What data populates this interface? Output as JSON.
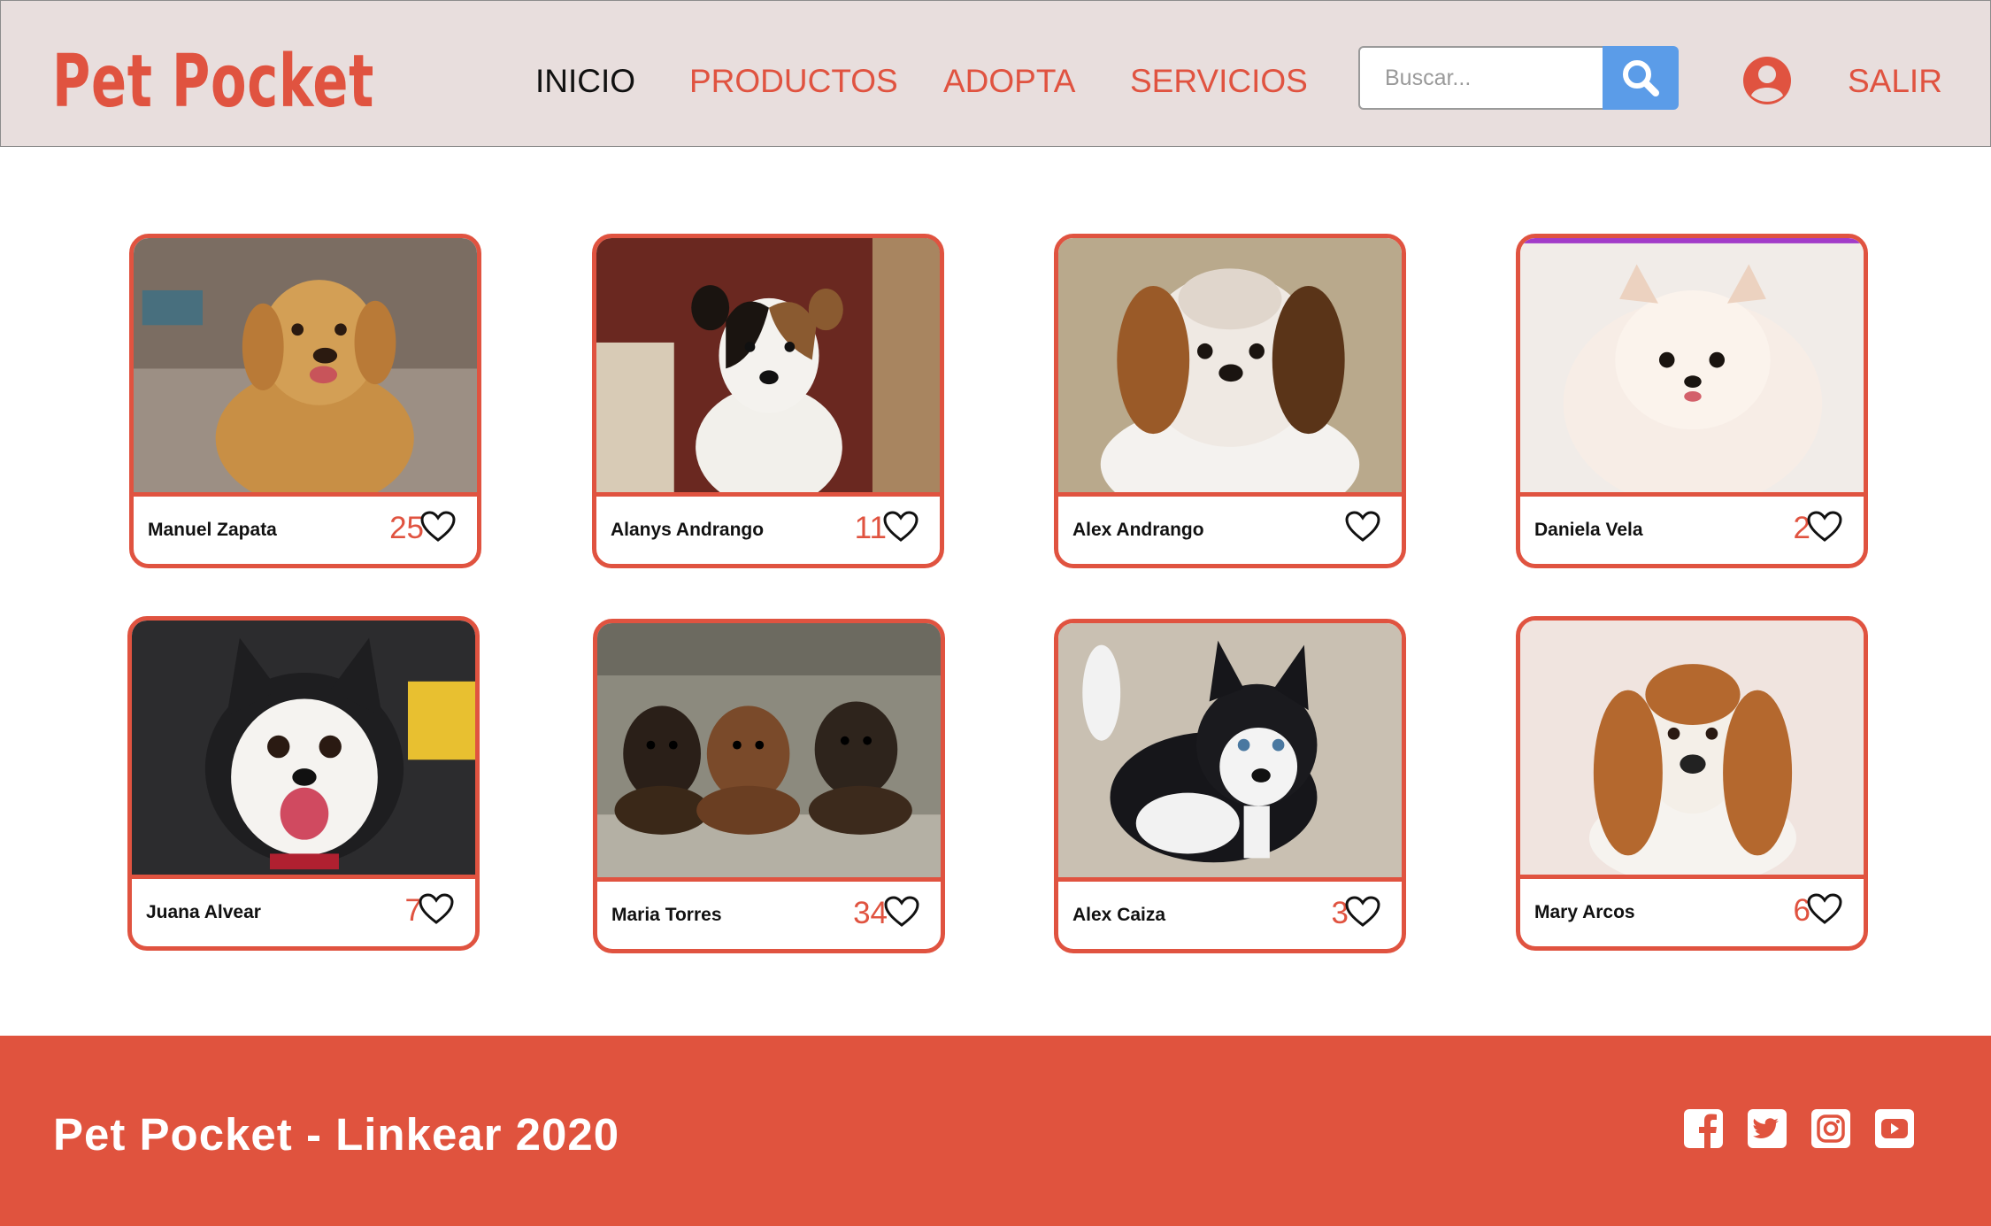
{
  "header": {
    "logo": "Pet Pocket",
    "nav": [
      {
        "label": "INICIO",
        "active": true
      },
      {
        "label": "PRODUCTOS",
        "active": false
      },
      {
        "label": "ADOPTA",
        "active": false
      },
      {
        "label": "SERVICIOS",
        "active": false
      }
    ],
    "search_placeholder": "Buscar...",
    "search_icon": "search-icon",
    "user_icon": "user-circle-icon",
    "logout_label": "SALIR"
  },
  "cards": [
    {
      "owner": "Manuel Zapata",
      "likes": "25",
      "photo": "golden-retriever-puppy"
    },
    {
      "owner": "Alanys Andrango",
      "likes": "11",
      "photo": "jack-russell-terrier"
    },
    {
      "owner": "Alex Andrango",
      "likes": "",
      "photo": "shih-tzu"
    },
    {
      "owner": "Daniela Vela",
      "likes": "2",
      "photo": "white-pomeranian"
    },
    {
      "owner": "Juana Alvear",
      "likes": "7",
      "photo": "husky-puppy-smiling"
    },
    {
      "owner": "Maria Torres",
      "likes": "34",
      "photo": "three-dachshund-puppies"
    },
    {
      "owner": "Alex Caiza",
      "likes": "3",
      "photo": "husky-puppy-standing"
    },
    {
      "owner": "Mary Arcos",
      "likes": "6",
      "photo": "basset-hound-puppy"
    }
  ],
  "footer": {
    "copyright": "Pet Pocket - Linkear 2020",
    "social": [
      "facebook-icon",
      "twitter-icon",
      "instagram-icon",
      "youtube-icon"
    ]
  },
  "colors": {
    "brand": "#e05340",
    "header_bg": "#e8dedd",
    "search_button": "#5b9ce8",
    "footer_bg": "#e0533e"
  }
}
